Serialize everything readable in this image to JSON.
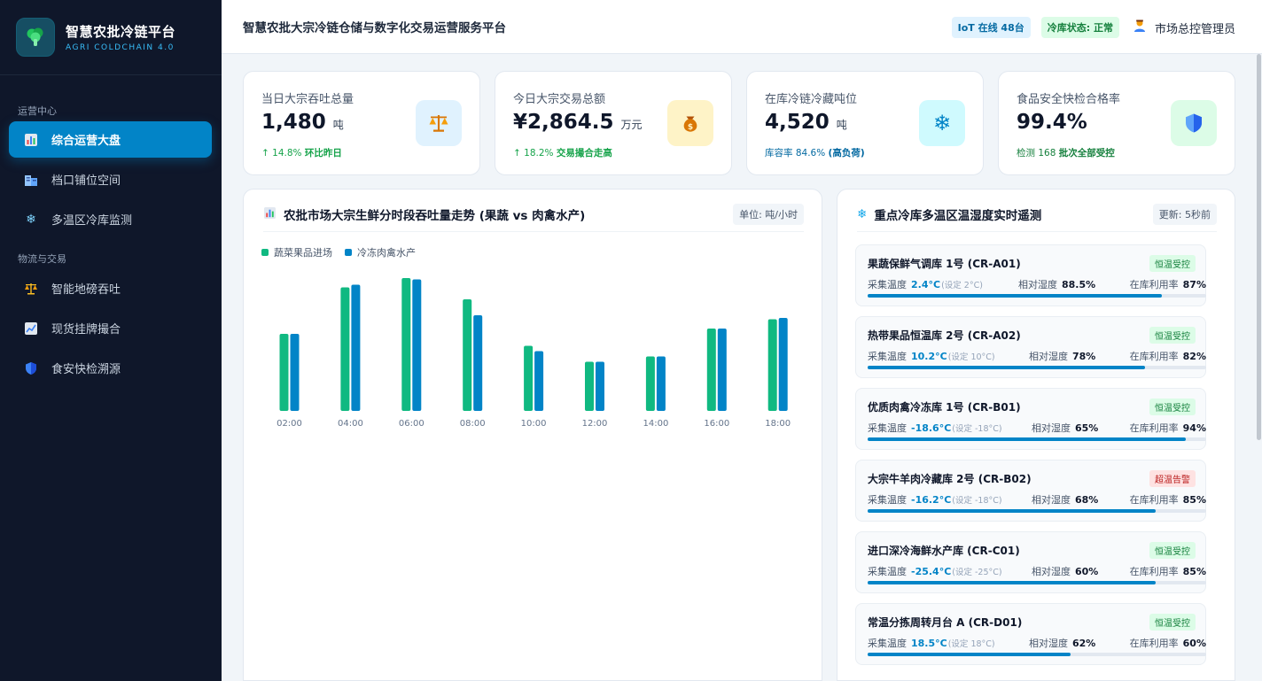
{
  "brand": {
    "title": "智慧农批冷链平台",
    "subtitle": "AGRI COLDCHAIN 4.0",
    "logo_icon": "broccoli-icon"
  },
  "sidebar": {
    "sections": [
      {
        "label": "运营中心"
      },
      {
        "label": "物流与交易"
      }
    ],
    "items": [
      {
        "label": "综合运营大盘",
        "icon": "bar-chart-icon",
        "active": true
      },
      {
        "label": "档口铺位空间",
        "icon": "buildings-icon"
      },
      {
        "label": "多温区冷库监测",
        "icon": "snowflake-icon"
      },
      {
        "label": "智能地磅吞吐",
        "icon": "scale-icon"
      },
      {
        "label": "现货挂牌撮合",
        "icon": "trend-chart-icon"
      },
      {
        "label": "食安快检溯源",
        "icon": "shield-icon"
      }
    ]
  },
  "header": {
    "title": "智慧农批大宗冷链仓储与数字化交易运营服务平台",
    "iot_badge": "IoT 在线 48台",
    "status_badge": "冷库状态: 正常",
    "user": "市场总控管理员"
  },
  "kpis": [
    {
      "label": "当日大宗吞吐总量",
      "value": "1,480",
      "unit": "吨",
      "sub_prefix": "↑ 14.8%",
      "sub_strong": "环比昨日",
      "sub_color": "#16a34a",
      "icon": "scale-icon",
      "icon_bg": "#e0f2fe"
    },
    {
      "label": "今日大宗交易总额",
      "value": "¥2,864.5",
      "unit": "万元",
      "sub_prefix": "↑ 18.2%",
      "sub_strong": "交易撮合走高",
      "sub_color": "#16a34a",
      "icon": "money-bag-icon",
      "icon_bg": "#fef3c7"
    },
    {
      "label": "在库冷链冷藏吨位",
      "value": "4,520",
      "unit": "吨",
      "sub_prefix": "库容率 84.6%",
      "sub_strong": "(高负荷)",
      "sub_color": "#0369a1",
      "icon": "snowflake-icon",
      "icon_bg": "#cffafe"
    },
    {
      "label": "食品安全快检合格率",
      "value": "99.4%",
      "unit": "",
      "sub_prefix": "检测 168",
      "sub_strong": "批次全部受控",
      "sub_color": "#15803d",
      "icon": "shield-icon",
      "icon_bg": "#dcfce7"
    }
  ],
  "chart_panel": {
    "title": "农批市场大宗生鲜分时段吞吐量走势 (果蔬 vs 肉禽水产)",
    "unit_tag": "单位: 吨/小时",
    "colors": {
      "series1": "#10b981",
      "series2": "#0284c7"
    }
  },
  "chart_data": {
    "type": "bar",
    "categories": [
      "02:00",
      "04:00",
      "06:00",
      "08:00",
      "10:00",
      "12:00",
      "14:00",
      "16:00",
      "18:00"
    ],
    "series": [
      {
        "name": "蔬菜果品进场",
        "values": [
          58,
          93,
          100,
          84,
          49,
          37,
          41,
          62,
          69
        ]
      },
      {
        "name": "冷冻肉禽水产",
        "values": [
          58,
          95,
          99,
          72,
          45,
          37,
          41,
          62,
          70
        ]
      }
    ],
    "ylim": [
      0,
      100
    ],
    "legend": "top-left",
    "grid": false
  },
  "rooms_panel": {
    "title": "重点冷库多温区温湿度实时遥测",
    "update_tag": "更新: 5秒前",
    "temp_label": "采集温度",
    "hum_label": "相对湿度",
    "util_label": "在库利用率",
    "rooms": [
      {
        "name": "果蔬保鲜气调库 1号 (CR-A01)",
        "status": "恒温受控",
        "warn": false,
        "temp": "2.4°C",
        "set": "(设定 2°C)",
        "hum": "88.5%",
        "util": "87%",
        "util_frac": 0.87
      },
      {
        "name": "热带果品恒温库 2号 (CR-A02)",
        "status": "恒温受控",
        "warn": false,
        "temp": "10.2°C",
        "set": "(设定 10°C)",
        "hum": "78%",
        "util": "82%",
        "util_frac": 0.82
      },
      {
        "name": "优质肉禽冷冻库 1号 (CR-B01)",
        "status": "恒温受控",
        "warn": false,
        "temp": "-18.6°C",
        "set": "(设定 -18°C)",
        "hum": "65%",
        "util": "94%",
        "util_frac": 0.94
      },
      {
        "name": "大宗牛羊肉冷藏库 2号 (CR-B02)",
        "status": "超温告警",
        "warn": true,
        "temp": "-16.2°C",
        "set": "(设定 -18°C)",
        "hum": "68%",
        "util": "85%",
        "util_frac": 0.85
      },
      {
        "name": "进口深冷海鲜水产库 (CR-C01)",
        "status": "恒温受控",
        "warn": false,
        "temp": "-25.4°C",
        "set": "(设定 -25°C)",
        "hum": "60%",
        "util": "85%",
        "util_frac": 0.85
      },
      {
        "name": "常温分拣周转月台 A (CR-D01)",
        "status": "恒温受控",
        "warn": false,
        "temp": "18.5°C",
        "set": "(设定 18°C)",
        "hum": "62%",
        "util": "60%",
        "util_frac": 0.6
      }
    ]
  }
}
